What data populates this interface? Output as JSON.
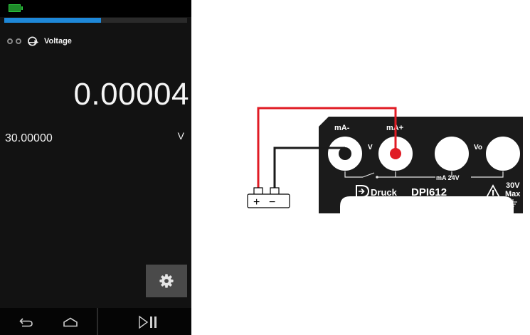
{
  "screen": {
    "function_label": "Voltage",
    "reading": "0.00004",
    "range_value": "30.00000",
    "unit": "V",
    "progress_fraction": 0.53,
    "icons": {
      "battery": "battery-icon",
      "function": "voltage-function-icon",
      "settings": "gear-icon",
      "back": "back-arrow-icon",
      "home": "home-icon",
      "play_pause": "play-pause-icon"
    }
  },
  "diagram": {
    "terminals": [
      "mA-",
      "mA+"
    ],
    "switch_labels": [
      "V",
      "Vo"
    ],
    "supply_label": "mA 24V",
    "brand": "Druck",
    "model": "DPI612",
    "voltage_warning": "30V",
    "max_label": "Max",
    "battery_plus": "+",
    "battery_minus": "−",
    "colors": {
      "positive_wire": "#e01b24",
      "negative_wire": "#1a1a1a",
      "panel": "#1b1b1b"
    }
  }
}
